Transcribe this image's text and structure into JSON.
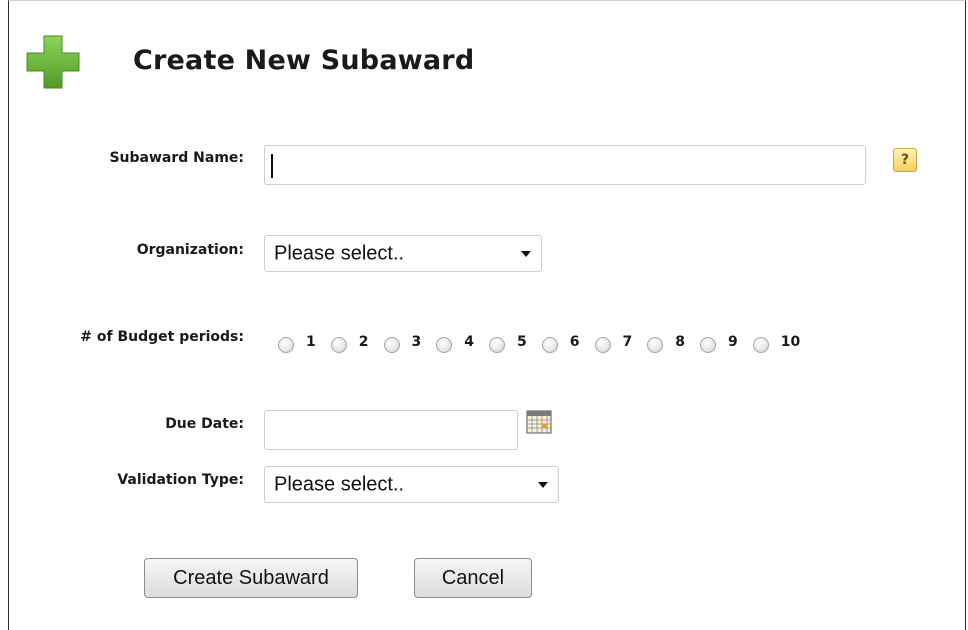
{
  "header": {
    "title": "Create New Subaward",
    "icon": "green-plus-icon"
  },
  "form": {
    "subaward_name": {
      "label": "Subaward Name:",
      "value": "",
      "help_icon": "?"
    },
    "organization": {
      "label": "Organization:",
      "selected": "Please select.."
    },
    "budget_periods": {
      "label": "# of Budget periods:",
      "options": [
        "1",
        "2",
        "3",
        "4",
        "5",
        "6",
        "7",
        "8",
        "9",
        "10"
      ]
    },
    "due_date": {
      "label": "Due Date:",
      "value": ""
    },
    "validation_type": {
      "label": "Validation Type:",
      "selected": "Please select.."
    }
  },
  "actions": {
    "create_label": "Create Subaward",
    "cancel_label": "Cancel"
  },
  "colors": {
    "accent_green": "#6cb33f",
    "help_yellow": "#f5cf5a"
  }
}
